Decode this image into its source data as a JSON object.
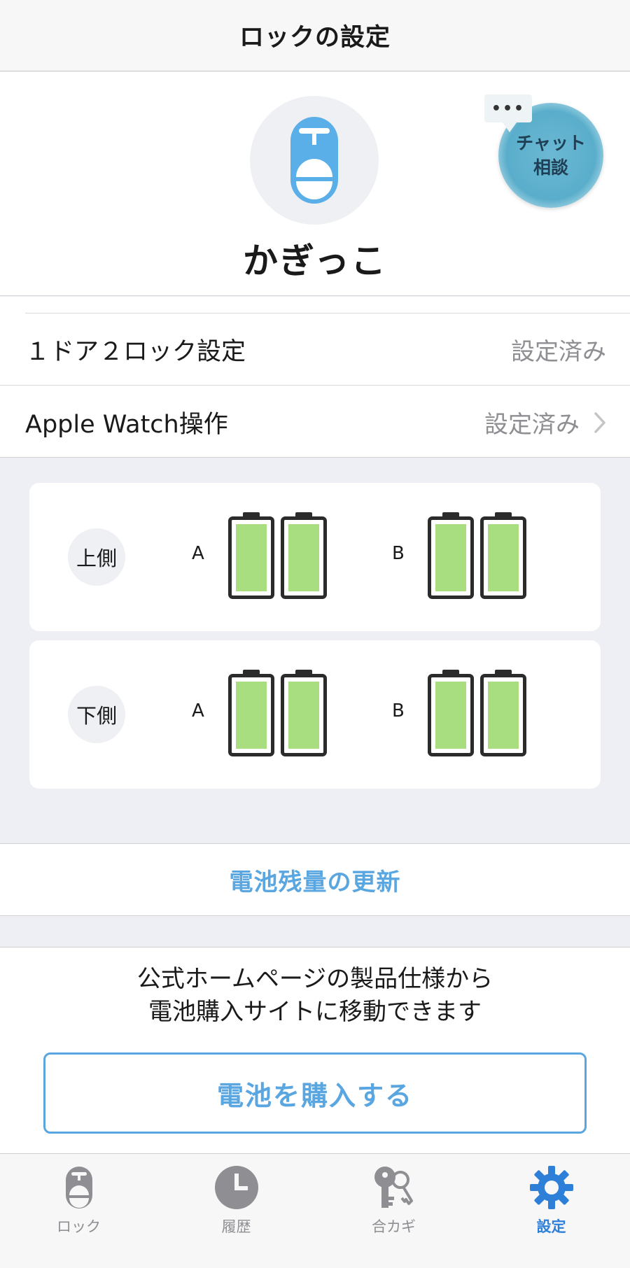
{
  "navbar": {
    "title": "ロックの設定"
  },
  "profile": {
    "device_name": "かぎっこ"
  },
  "chat": {
    "bubble": "•••",
    "line1": "チャット",
    "line2": "相談"
  },
  "settings": {
    "rows": [
      {
        "label": "１ドア２ロック設定",
        "value": "設定済み"
      },
      {
        "label": "Apple Watch操作",
        "value": "設定済み"
      }
    ]
  },
  "battery": {
    "cards": [
      {
        "side": "上側",
        "group_a": "A",
        "group_b": "B",
        "levels": [
          1.0,
          1.0,
          1.0,
          1.0
        ]
      },
      {
        "side": "下側",
        "group_a": "A",
        "group_b": "B",
        "levels": [
          1.0,
          1.0,
          1.0,
          1.0
        ]
      }
    ],
    "fill_color": "#a8dd80"
  },
  "refresh": {
    "label": "電池残量の更新"
  },
  "buy": {
    "text_line1": "公式ホームページの製品仕様から",
    "text_line2": "電池購入サイトに移動できます",
    "button_label": "電池を購入する"
  },
  "tabs": [
    {
      "label": "ロック",
      "icon": "lock-icon",
      "active": false
    },
    {
      "label": "履歴",
      "icon": "clock-icon",
      "active": false
    },
    {
      "label": "合カギ",
      "icon": "keys-icon",
      "active": false
    },
    {
      "label": "設定",
      "icon": "gear-icon",
      "active": true
    }
  ],
  "colors": {
    "accent": "#5aa6e0",
    "active_tab": "#2e7fd8",
    "lock_icon": "#5aafe8"
  }
}
